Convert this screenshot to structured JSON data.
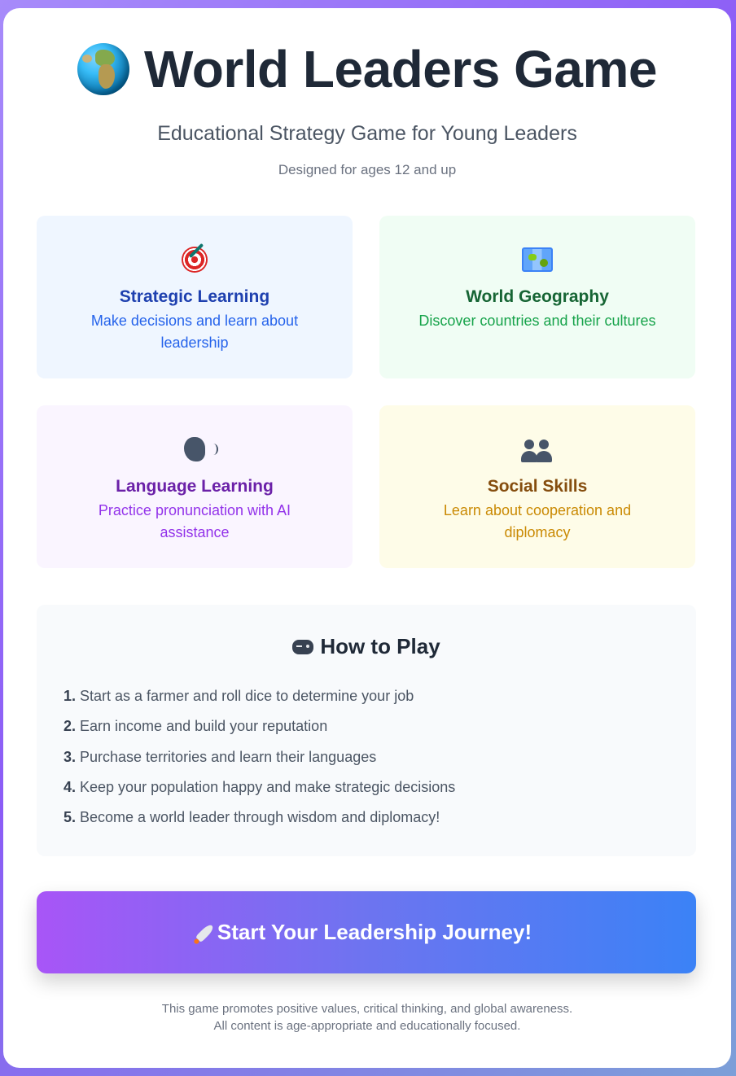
{
  "header": {
    "title": "World Leaders Game",
    "subtitle": "Educational Strategy Game for Young Leaders",
    "ages": "Designed for ages 12 and up"
  },
  "features": [
    {
      "icon": "target-icon",
      "title": "Strategic Learning",
      "description": "Make decisions and learn about leadership",
      "title_color": "#1e40af",
      "bg": "#eff6ff"
    },
    {
      "icon": "map-icon",
      "title": "World Geography",
      "description": "Discover countries and their cultures",
      "title_color": "#166534",
      "bg": "#f0fdf4"
    },
    {
      "icon": "speaking-head-icon",
      "title": "Language Learning",
      "description": "Practice pronunciation with AI assistance",
      "title_color": "#6b21a8",
      "bg": "#faf5ff"
    },
    {
      "icon": "people-icon",
      "title": "Social Skills",
      "description": "Learn about cooperation and diplomacy",
      "title_color": "#854d0e",
      "bg": "#fefce8"
    }
  ],
  "how_to_play": {
    "title": "How to Play",
    "steps": [
      {
        "num": "1.",
        "text": "Start as a farmer and roll dice to determine your job"
      },
      {
        "num": "2.",
        "text": "Earn income and build your reputation"
      },
      {
        "num": "3.",
        "text": "Purchase territories and learn their languages"
      },
      {
        "num": "4.",
        "text": "Keep your population happy and make strategic decisions"
      },
      {
        "num": "5.",
        "text": "Become a world leader through wisdom and diplomacy!"
      }
    ]
  },
  "start_button": {
    "label": "Start Your Leadership Journey!",
    "gradient_from": "#a855f7",
    "gradient_to": "#3b82f6"
  },
  "footer": {
    "line1": "This game promotes positive values, critical thinking, and global awareness.",
    "line2": "All content is age-appropriate and educationally focused."
  }
}
